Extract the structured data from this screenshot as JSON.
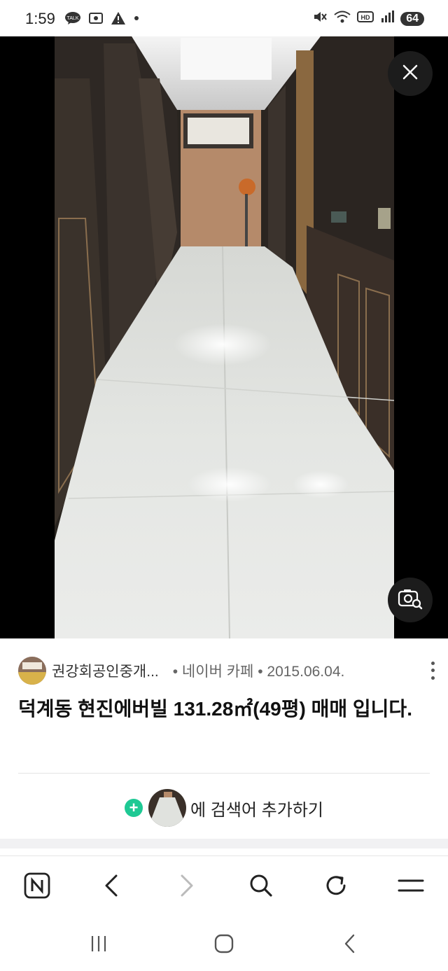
{
  "status_bar": {
    "time": "1:59",
    "left_icons": [
      "talk-icon",
      "screenshot-icon",
      "warning-icon",
      "dot-icon"
    ],
    "right_icons": [
      "mute-icon",
      "wifi-icon",
      "hd-icon",
      "signal-icon"
    ],
    "battery": "64"
  },
  "viewer": {
    "close_icon": "close-icon",
    "lens_icon": "image-search-icon"
  },
  "result": {
    "source_name": "권강회공인중개...",
    "source_meta": "• 네이버 카페 • 2015.06.04.",
    "title": "덕계동 현진에버빌 131.28㎡(49평) 매매 입니다.",
    "add_search_text": "에 검색어 추가하기"
  },
  "toolbar": {
    "icons": [
      "naver-home-icon",
      "back-icon",
      "forward-icon",
      "search-icon",
      "refresh-icon",
      "menu-icon"
    ]
  },
  "system_nav": {
    "icons": [
      "recents-icon",
      "home-icon",
      "back-nav-icon"
    ]
  },
  "colors": {
    "accent_green": "#1ec994",
    "viewer_bg": "#000000"
  }
}
